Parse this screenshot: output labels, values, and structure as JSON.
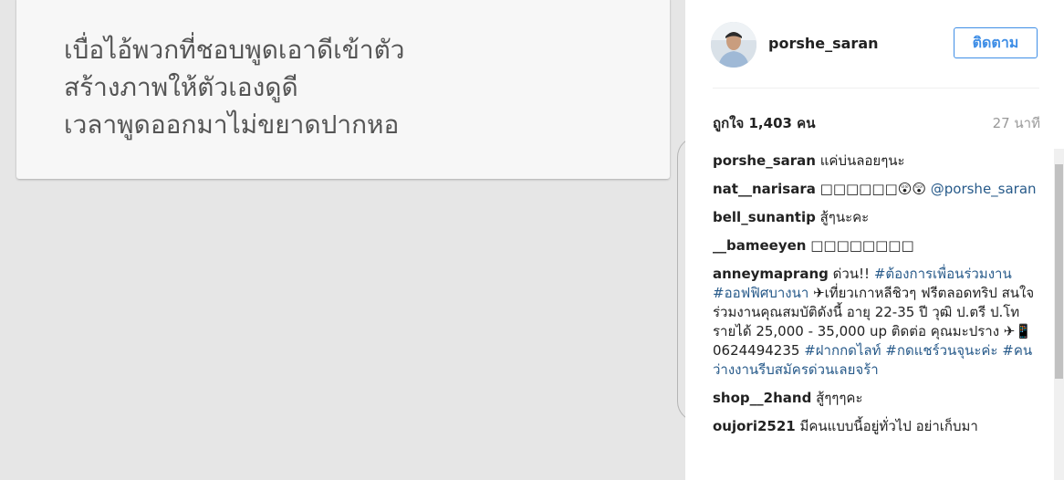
{
  "post": {
    "lines": [
      "เบื่อไอ้พวกที่ชอบพูดเอาดีเข้าตัว",
      "สร้างภาพให้ตัวเองดูดี",
      "เวลาพูดออกมาไม่ขยาดปากหอ"
    ]
  },
  "header": {
    "username": "porshe_saran",
    "follow_label": "ติดตาม"
  },
  "stats": {
    "likes": "ถูกใจ 1,403 คน",
    "time": "27 นาที"
  },
  "comments": [
    {
      "author": "porshe_saran",
      "parts": [
        {
          "text": " แค่บ่นลอยๆนะ"
        }
      ]
    },
    {
      "author": "nat__narisara",
      "parts": [
        {
          "text": " □□□□□□😲😲 "
        },
        {
          "text": "@porshe_saran",
          "tag": true
        }
      ]
    },
    {
      "author": "bell_sunantip",
      "parts": [
        {
          "text": " สู้ๆนะคะ"
        }
      ]
    },
    {
      "author": "__bameeyen",
      "parts": [
        {
          "text": " □□□□□□□□"
        }
      ]
    },
    {
      "author": "anneymaprang",
      "parts": [
        {
          "text": " ด่วน!! "
        },
        {
          "text": "#ต้องการเพื่อนร่วมงาน",
          "tag": true
        },
        {
          "text": " "
        },
        {
          "text": "#ออฟฟิศบางนา",
          "tag": true
        },
        {
          "text": " ✈เที่ยวเกาหลีชิวๆ ฟรีตลอดทริป สนใจร่วมงานคุณสมบัติดังนี้ อายุ 22-35 ปี วุฒิ ป.ตรี ป.โท รายได้ 25,000 - 35,000 up ติดต่อ คุณมะปราง ✈📱 0624494235 "
        },
        {
          "text": "#ฝากกดไลท์",
          "tag": true
        },
        {
          "text": " "
        },
        {
          "text": "#กดแชร์วนจุนะค่ะ",
          "tag": true
        },
        {
          "text": " "
        },
        {
          "text": "#คนว่างงานรีบสมัครด่วนเลยจร้า",
          "tag": true
        }
      ]
    },
    {
      "author": "shop__2hand",
      "parts": [
        {
          "text": " สู้ๆๆๆคะ"
        }
      ]
    },
    {
      "author": "oujori2521",
      "parts": [
        {
          "text": " มีคนแบบนี้อยู่ทั่วไป อย่าเก็บมา"
        }
      ]
    }
  ],
  "colors": {
    "background": "#e6e6e6",
    "accent": "#3f8ee6",
    "tag": "#275a8a"
  }
}
